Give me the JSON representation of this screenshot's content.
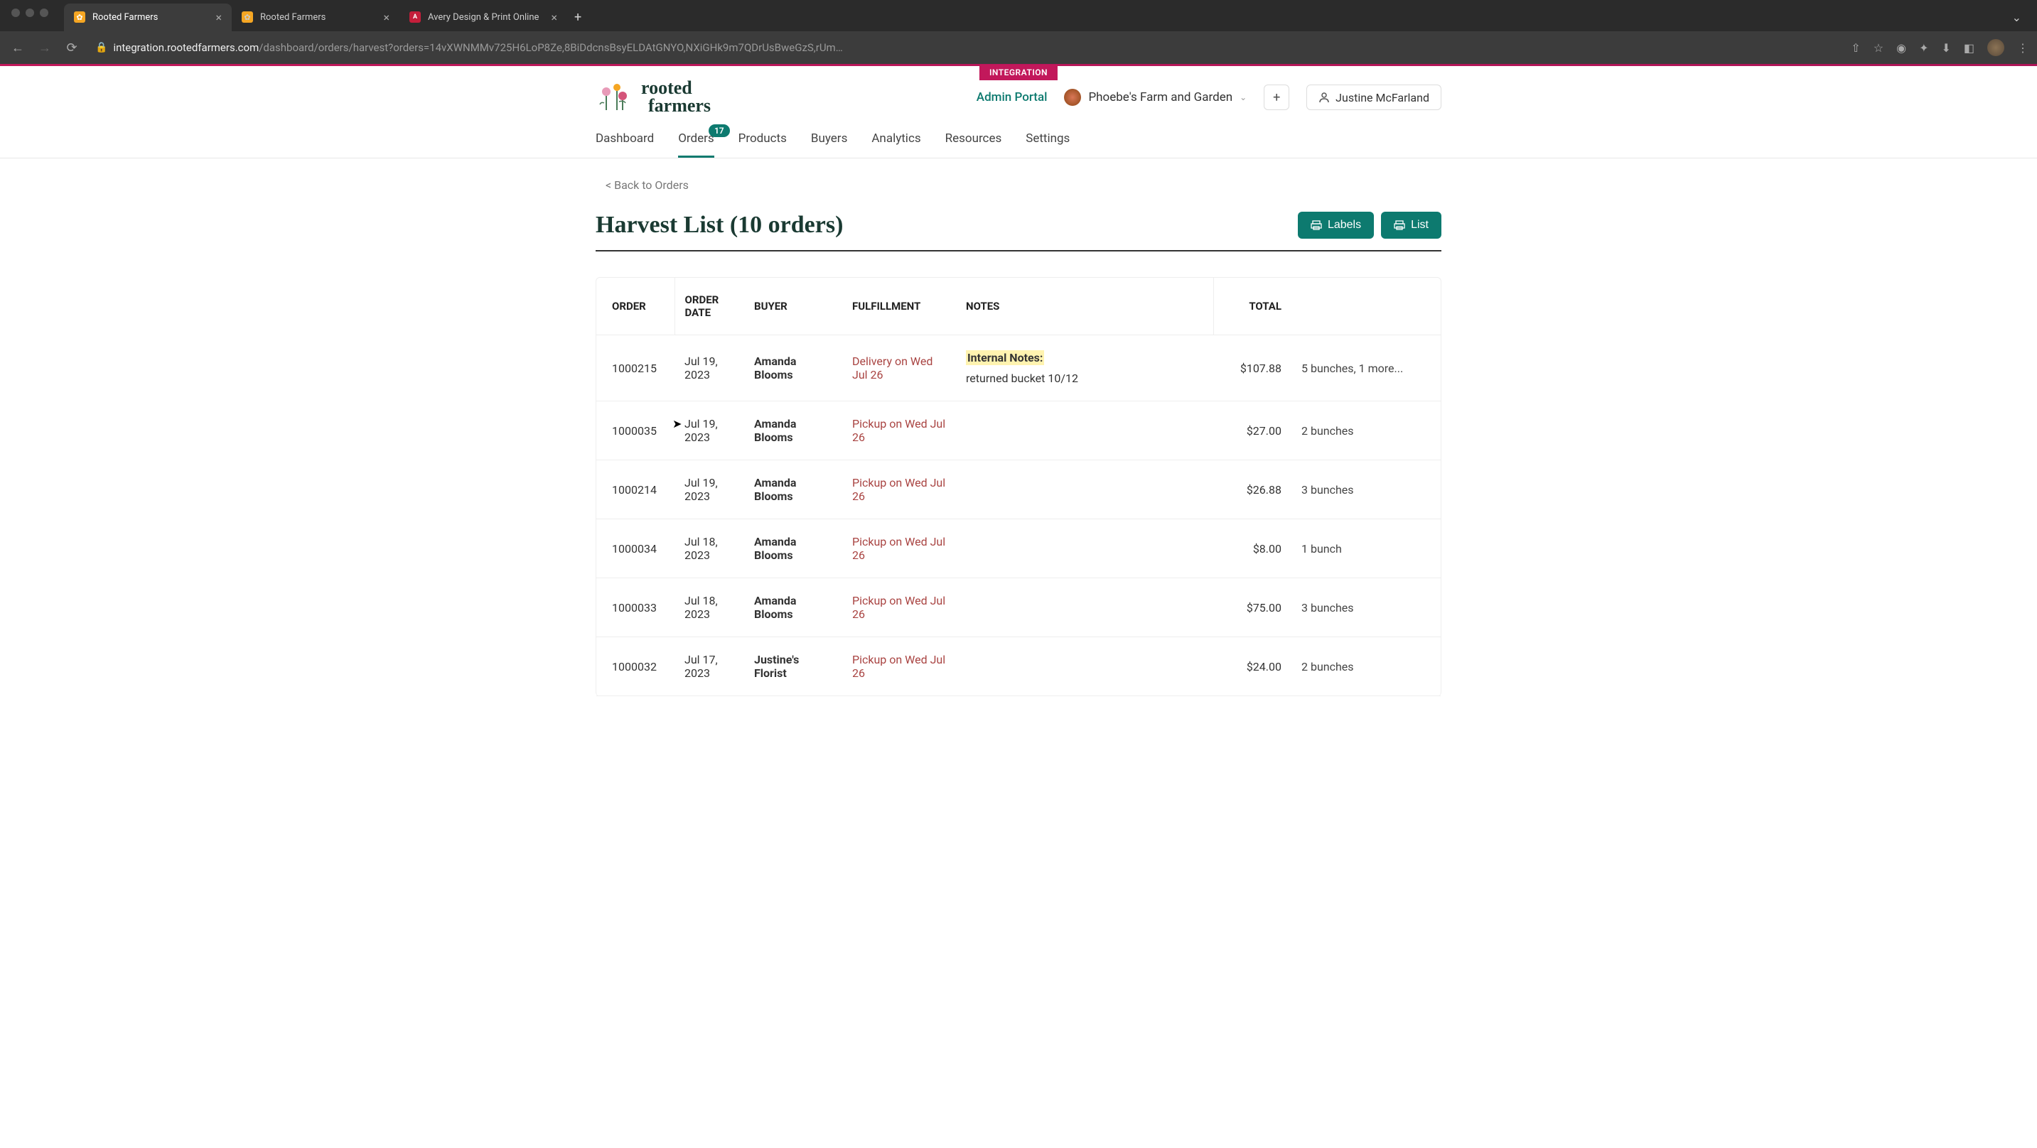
{
  "browser": {
    "tabs": [
      {
        "title": "Rooted Farmers",
        "favicon": "rooted",
        "active": true
      },
      {
        "title": "Rooted Farmers",
        "favicon": "rooted",
        "active": false
      },
      {
        "title": "Avery Design & Print Online",
        "favicon": "avery",
        "active": false
      }
    ],
    "url_host": "integration.rootedfarmers.com",
    "url_path": "/dashboard/orders/harvest?orders=14vXWNMMv725H6LoP8Ze,8BiDdcnsBsyELDAtGNYO,NXiGHk9m7QDrUsBweGzS,rUm…"
  },
  "header": {
    "integration_badge": "INTEGRATION",
    "logo_text_1": "rooted",
    "logo_text_2": "farmers",
    "admin_portal": "Admin Portal",
    "farm_name": "Phoebe's Farm and Garden",
    "user_name": "Justine McFarland"
  },
  "nav": {
    "items": [
      {
        "label": "Dashboard"
      },
      {
        "label": "Orders",
        "badge": "17",
        "active": true
      },
      {
        "label": "Products"
      },
      {
        "label": "Buyers"
      },
      {
        "label": "Analytics"
      },
      {
        "label": "Resources"
      },
      {
        "label": "Settings"
      }
    ]
  },
  "page": {
    "back_link": "< Back to Orders",
    "title": "Harvest List (10 orders)",
    "labels_btn": "Labels",
    "list_btn": "List"
  },
  "table": {
    "columns": {
      "order": "ORDER",
      "order_date": "ORDER DATE",
      "buyer": "BUYER",
      "fulfillment": "FULFILLMENT",
      "notes": "NOTES",
      "total": "TOTAL",
      "summary": ""
    },
    "internal_notes_label": "Internal Notes:",
    "rows": [
      {
        "order": "1000215",
        "date": "Jul 19, 2023",
        "buyer": "Amanda Blooms",
        "fulfillment": "Delivery on Wed Jul 26",
        "notes": "returned bucket 10/12",
        "has_internal_notes": true,
        "total": "$107.88",
        "summary": "5 bunches, 1 more..."
      },
      {
        "order": "1000035",
        "date": "Jul 19, 2023",
        "buyer": "Amanda Blooms",
        "fulfillment": "Pickup on Wed Jul 26",
        "notes": "",
        "total": "$27.00",
        "summary": "2 bunches"
      },
      {
        "order": "1000214",
        "date": "Jul 19, 2023",
        "buyer": "Amanda Blooms",
        "fulfillment": "Pickup on Wed Jul 26",
        "notes": "",
        "total": "$26.88",
        "summary": "3 bunches"
      },
      {
        "order": "1000034",
        "date": "Jul 18, 2023",
        "buyer": "Amanda Blooms",
        "fulfillment": "Pickup on Wed Jul 26",
        "notes": "",
        "total": "$8.00",
        "summary": "1 bunch"
      },
      {
        "order": "1000033",
        "date": "Jul 18, 2023",
        "buyer": "Amanda Blooms",
        "fulfillment": "Pickup on Wed Jul 26",
        "notes": "",
        "total": "$75.00",
        "summary": "3 bunches"
      },
      {
        "order": "1000032",
        "date": "Jul 17, 2023",
        "buyer": "Justine's Florist",
        "fulfillment": "Pickup on Wed Jul 26",
        "notes": "",
        "total": "$24.00",
        "summary": "2 bunches"
      }
    ]
  }
}
